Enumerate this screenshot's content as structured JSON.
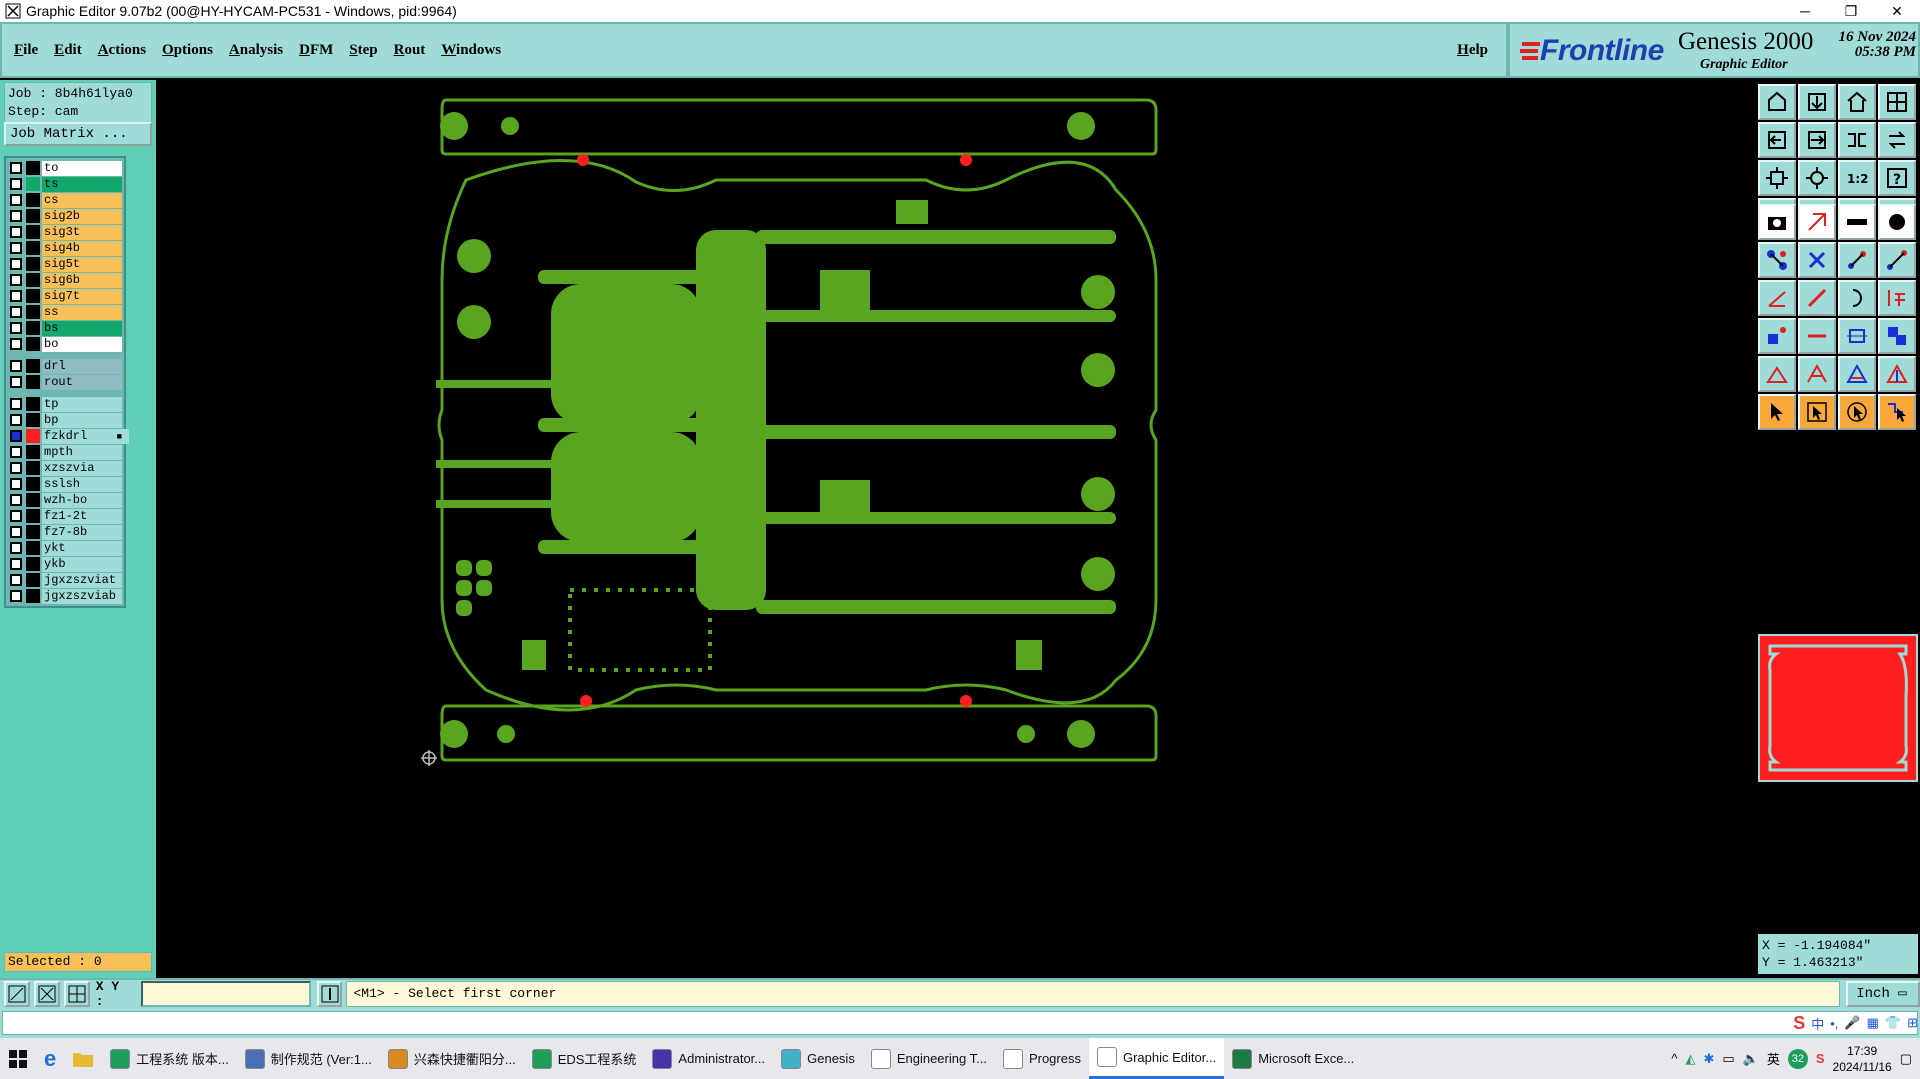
{
  "titlebar": {
    "title": "Graphic Editor 9.07b2 (00@HY-HYCAM-PC531 - Windows, pid:9964)",
    "minimize": "─",
    "restore": "❐",
    "close": "✕"
  },
  "menu": {
    "items": [
      "File",
      "Edit",
      "Actions",
      "Options",
      "Analysis",
      "DFM",
      "Step",
      "Rout",
      "Windows"
    ],
    "help": "Help"
  },
  "brand": {
    "logo": "Frontline",
    "product": "Genesis 2000",
    "subtitle": "Graphic Editor",
    "date_line1": "16 Nov 2024",
    "date_line2": "05:38 PM"
  },
  "job": {
    "job_line": "Job  : 8b4h61lya0",
    "step_line": "Step: cam",
    "matrix_button": "Job Matrix ..."
  },
  "layers": {
    "group1": [
      {
        "name": "to",
        "color": "#ffffff",
        "sw": "#000000"
      },
      {
        "name": "ts",
        "color": "#12a86c",
        "sw": "#12a86c"
      },
      {
        "name": "cs",
        "color": "#f7c15a",
        "sw": "#000000"
      },
      {
        "name": "sig2b",
        "color": "#f7c15a",
        "sw": "#000000"
      },
      {
        "name": "sig3t",
        "color": "#f7c15a",
        "sw": "#000000"
      },
      {
        "name": "sig4b",
        "color": "#f7c15a",
        "sw": "#000000"
      },
      {
        "name": "sig5t",
        "color": "#f7c15a",
        "sw": "#000000"
      },
      {
        "name": "sig6b",
        "color": "#f7c15a",
        "sw": "#000000"
      },
      {
        "name": "sig7t",
        "color": "#f7c15a",
        "sw": "#000000"
      },
      {
        "name": "ss",
        "color": "#f7c15a",
        "sw": "#000000"
      },
      {
        "name": "bs",
        "color": "#12a86c",
        "sw": "#000000"
      },
      {
        "name": "bo",
        "color": "#ffffff",
        "sw": "#000000"
      }
    ],
    "group2": [
      {
        "name": "drl",
        "color": "#8fbcc4",
        "sw": "#000000"
      },
      {
        "name": "rout",
        "color": "#8fbcc4",
        "sw": "#000000"
      }
    ],
    "group3": [
      {
        "name": "tp",
        "color": "#9fdcd8",
        "sw": "#000000"
      },
      {
        "name": "bp",
        "color": "#9fdcd8",
        "sw": "#000000"
      },
      {
        "name": "fzkdrl",
        "color": "#9fdcd8",
        "sw": "#ff1f1f",
        "active": true,
        "mark": "■"
      },
      {
        "name": "mpth",
        "color": "#9fdcd8",
        "sw": "#000000"
      },
      {
        "name": "xzszvia",
        "color": "#9fdcd8",
        "sw": "#000000"
      },
      {
        "name": "sslsh",
        "color": "#9fdcd8",
        "sw": "#000000"
      },
      {
        "name": "wzh-bo",
        "color": "#9fdcd8",
        "sw": "#000000"
      },
      {
        "name": "fz1-2t",
        "color": "#9fdcd8",
        "sw": "#000000"
      },
      {
        "name": "fz7-8b",
        "color": "#9fdcd8",
        "sw": "#000000"
      },
      {
        "name": "ykt",
        "color": "#9fdcd8",
        "sw": "#000000"
      },
      {
        "name": "ykb",
        "color": "#9fdcd8",
        "sw": "#000000"
      },
      {
        "name": "jgxzszviat",
        "color": "#9fdcd8",
        "sw": "#000000"
      },
      {
        "name": "jgxzszviab",
        "color": "#9fdcd8",
        "sw": "#000000"
      }
    ]
  },
  "status": {
    "selected": "Selected : 0"
  },
  "coords": {
    "x": "X = -1.194084\"",
    "y": "Y =  1.463213\""
  },
  "command": {
    "xy_label": "X Y :",
    "xy_value": "",
    "prompt": "<M1> - Select first corner",
    "units": "Inch ▭"
  },
  "ime": {
    "items": [
      "中",
      "•,",
      "🎤",
      "▦",
      "👕",
      "⊞"
    ]
  },
  "taskbar": {
    "items": [
      {
        "label": "工程系统  版本...",
        "icon_color": "#1e9e5a"
      },
      {
        "label": "制作规范 (Ver:1...",
        "icon_color": "#4a6fb5"
      },
      {
        "label": "兴森快捷衢阳分...",
        "icon_color": "#d88a1f"
      },
      {
        "label": "EDS工程系统",
        "icon_color": "#1e9e5a"
      },
      {
        "label": "Administrator...",
        "icon_color": "#4433aa"
      },
      {
        "label": "Genesis",
        "icon_color": "#3fb0c8"
      },
      {
        "label": "Engineering T...",
        "icon_color": "#ffffff"
      },
      {
        "label": "Progress",
        "icon_color": "#ffffff"
      },
      {
        "label": "Graphic Editor...",
        "icon_color": "#ffffff",
        "active": true
      },
      {
        "label": "Microsoft Exce...",
        "icon_color": "#1d7a43"
      }
    ],
    "tray_lang": "英",
    "tray_badge": "32",
    "time": "17:39",
    "date": "2024/11/16"
  },
  "colors": {
    "copper": "#5aa51f",
    "fiducial": "#ff1f1f",
    "panel": "#9fdcd8",
    "layer_active": "#f7c15a"
  }
}
